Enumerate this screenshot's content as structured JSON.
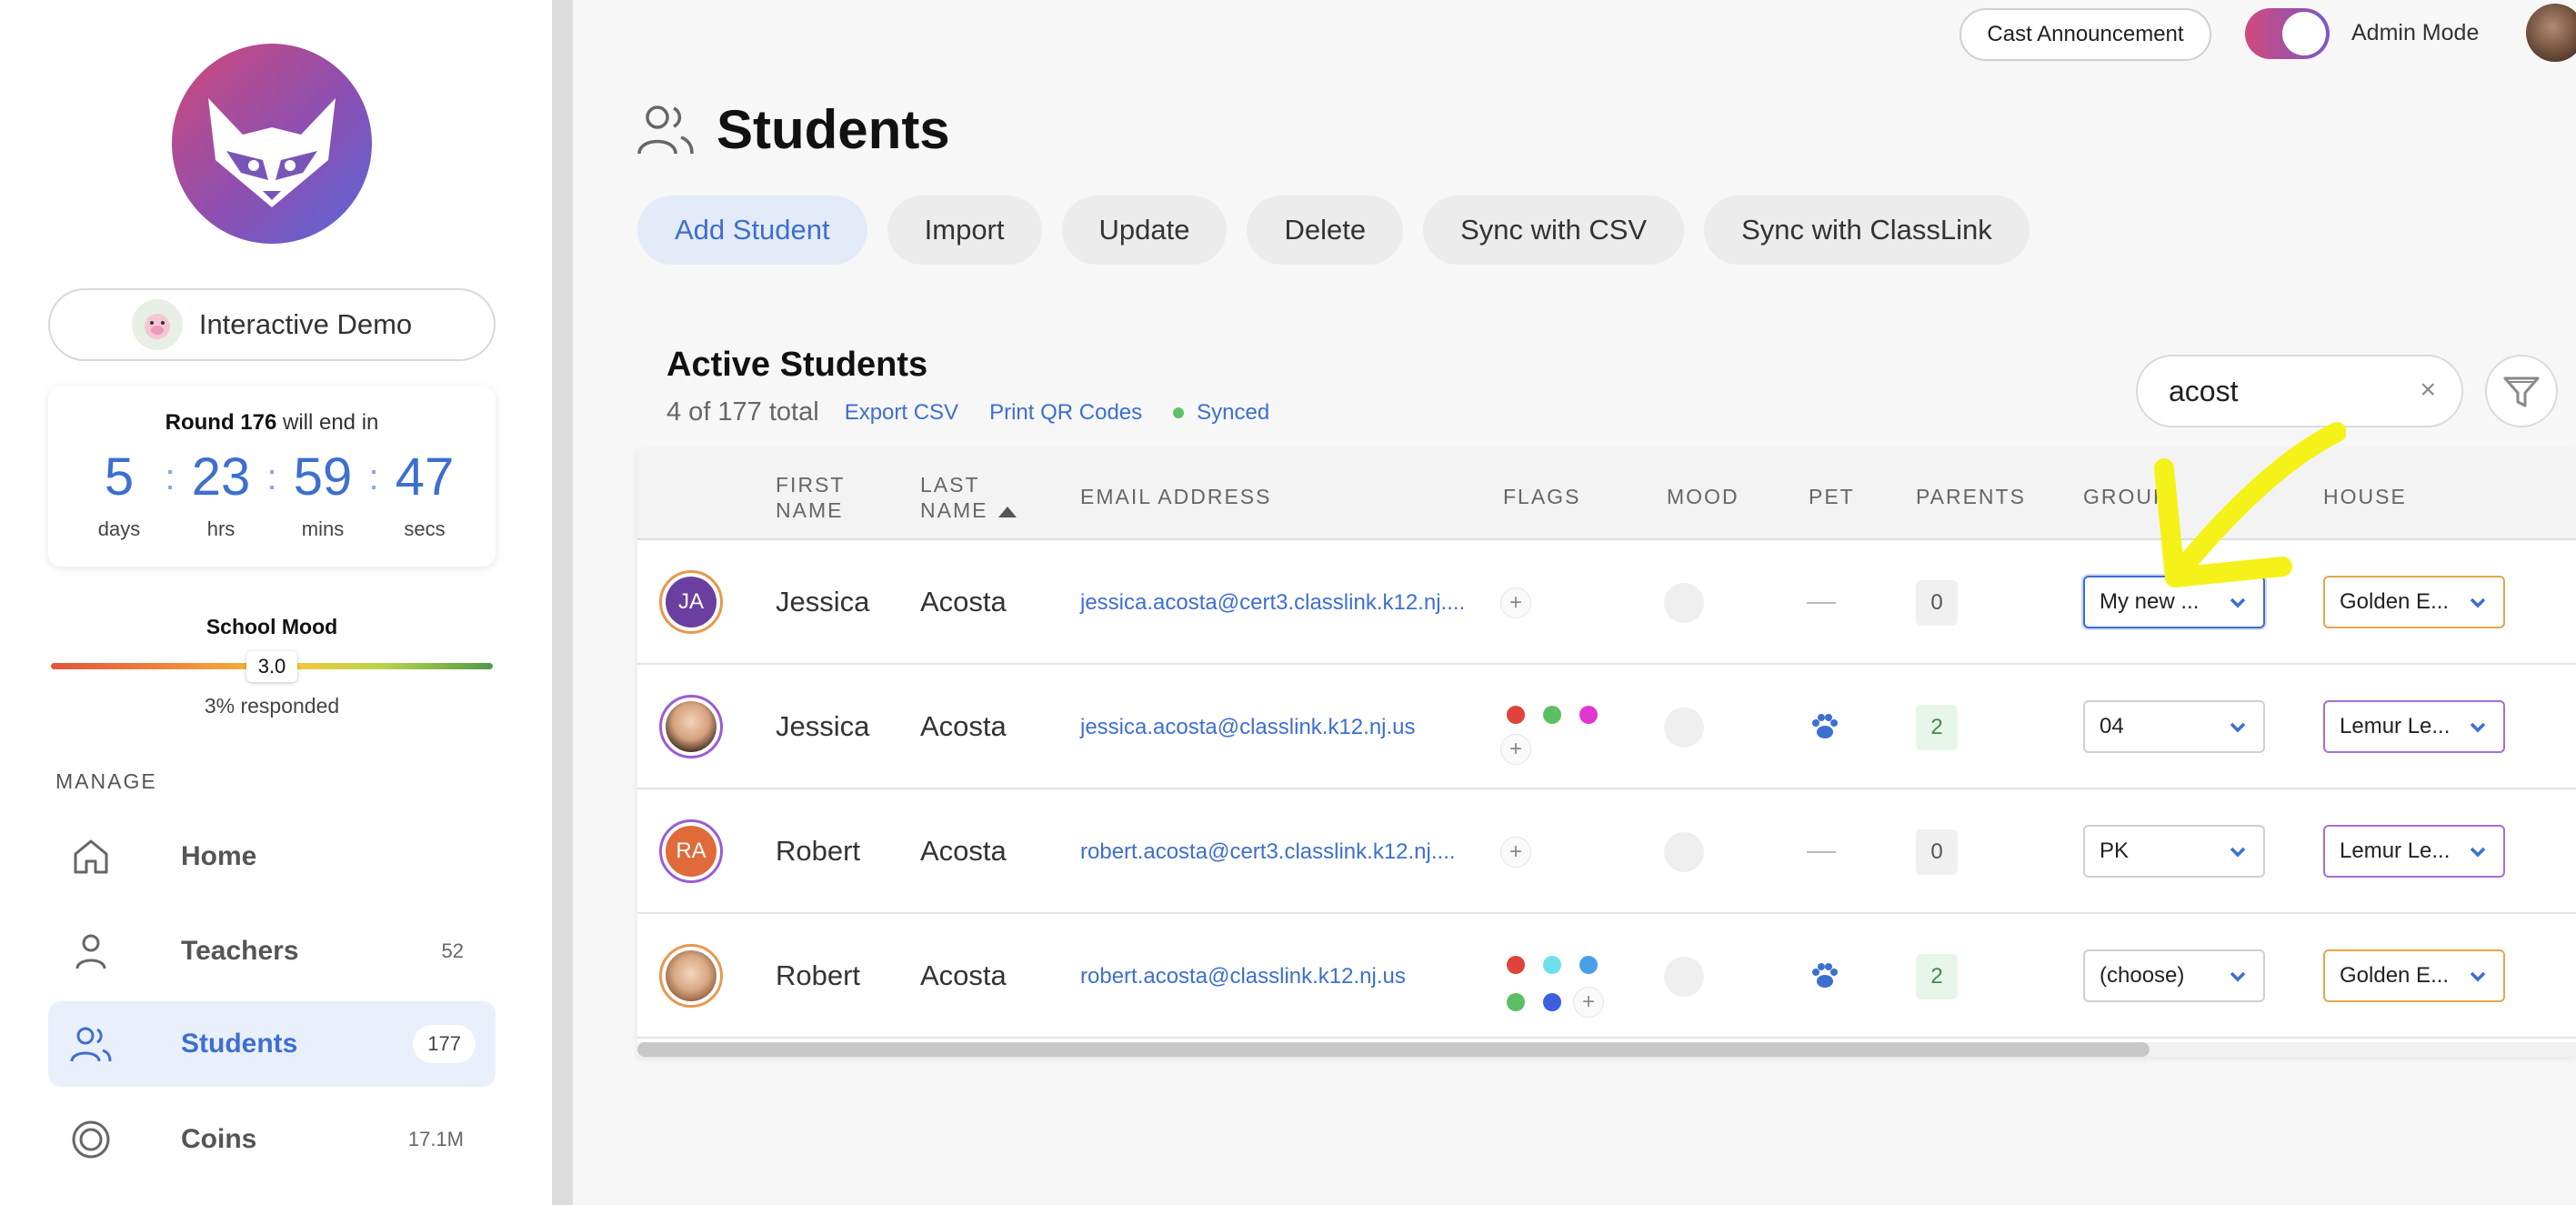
{
  "app": {
    "demo_label": "Interactive Demo"
  },
  "round": {
    "prefix": "Round 176",
    "suffix": " will end in",
    "days": "5",
    "hours": "23",
    "mins": "59",
    "secs": "47",
    "days_label": "days",
    "hours_label": "hrs",
    "mins_label": "mins",
    "secs_label": "secs"
  },
  "school_mood": {
    "title": "School Mood",
    "value": "3.0",
    "level": 0.5,
    "responded": "3% responded"
  },
  "sidebar": {
    "section": "MANAGE",
    "items": [
      {
        "label": "Home",
        "count": ""
      },
      {
        "label": "Teachers",
        "count": "52"
      },
      {
        "label": "Students",
        "count": "177"
      },
      {
        "label": "Coins",
        "count": "17.1M"
      }
    ]
  },
  "topbar": {
    "cast": "Cast Announcement",
    "admin": "Admin Mode"
  },
  "page": {
    "title": "Students",
    "actions": [
      "Add Student",
      "Import",
      "Update",
      "Delete",
      "Sync with CSV",
      "Sync with ClassLink"
    ]
  },
  "card": {
    "title": "Active Students",
    "total": "4 of 177 total",
    "export": "Export CSV",
    "print": "Print QR Codes",
    "synced": "Synced",
    "search_value": "acost",
    "clear": "×"
  },
  "table": {
    "headers": {
      "first1": "FIRST",
      "first2": "NAME",
      "last1": "LAST",
      "last2": "NAME",
      "email": "EMAIL ADDRESS",
      "flags": "FLAGS",
      "mood": "MOOD",
      "pet": "PET",
      "parents": "PARENTS",
      "group": "GROUP",
      "house": "HOUSE"
    },
    "rows": [
      {
        "initials": "JA",
        "first": "Jessica",
        "last": "Acosta",
        "email": "jessica.acosta@cert3.classlink.k12.nj....",
        "parents": "0",
        "group": "My new ...",
        "house": "Golden E..."
      },
      {
        "initials": "",
        "first": "Jessica",
        "last": "Acosta",
        "email": "jessica.acosta@classlink.k12.nj.us",
        "parents": "2",
        "group": "04",
        "house": "Lemur Le..."
      },
      {
        "initials": "RA",
        "first": "Robert",
        "last": "Acosta",
        "email": "robert.acosta@cert3.classlink.k12.nj....",
        "parents": "0",
        "group": "PK",
        "house": "Lemur Le..."
      },
      {
        "initials": "",
        "first": "Robert",
        "last": "Acosta",
        "email": "robert.acosta@classlink.k12.nj.us",
        "parents": "2",
        "group": "(choose)",
        "house": "Golden E..."
      }
    ],
    "plus": "+",
    "scroll_fraction": 0.78
  },
  "colors": {
    "accent": "#3d6fcf",
    "annotation": "#f5f21a",
    "flag_red": "#e0433a",
    "flag_green": "#5cc062",
    "flag_magenta": "#e236d0",
    "flag_cyan": "#6fe0ea",
    "flag_blue": "#4aa0e8",
    "flag_navy": "#3b5fe0"
  }
}
